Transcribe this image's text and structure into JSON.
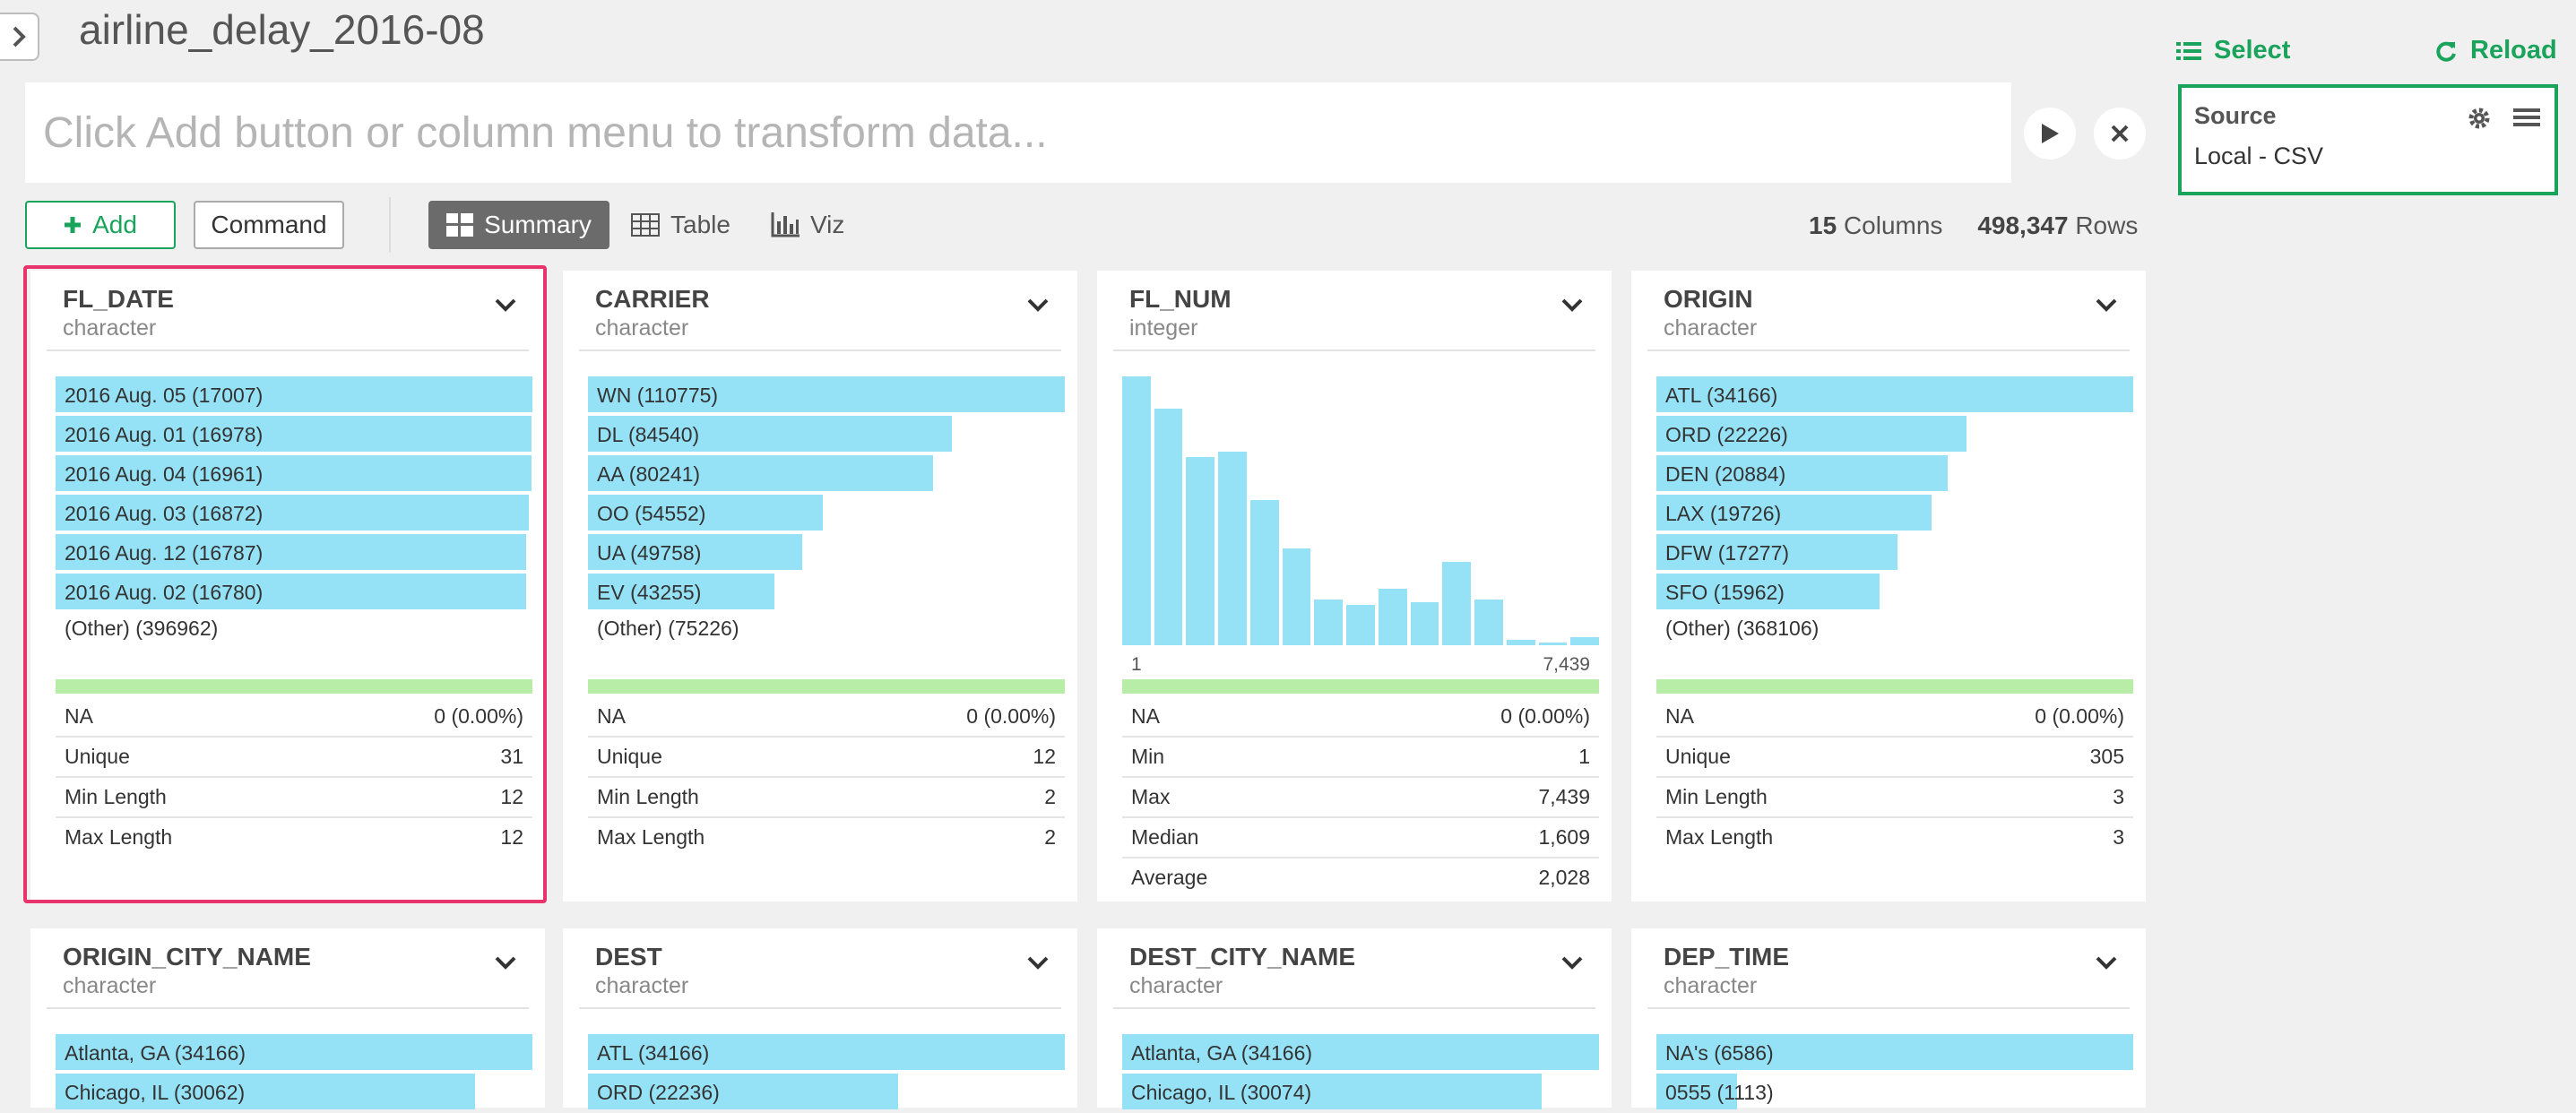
{
  "title": "airline_delay_2016-08",
  "command_placeholder": "Click Add button or column menu to transform data...",
  "right_panel": {
    "select_label": "Select",
    "reload_label": "Reload",
    "source_title": "Source",
    "source_value": "Local - CSV"
  },
  "toolbar": {
    "add_label": "Add",
    "command_label": "Command",
    "summary_label": "Summary",
    "table_label": "Table",
    "viz_label": "Viz",
    "columns_count": "15",
    "columns_label": "Columns",
    "rows_count": "498,347",
    "rows_label": "Rows"
  },
  "colors": {
    "accent": "#1aa35b",
    "bar": "#95e1f5",
    "na_bar": "#b8eda7",
    "selection": "#e8336b"
  },
  "cards": [
    {
      "name": "FL_DATE",
      "type": "character",
      "selected": true,
      "bars": [
        {
          "label": "2016 Aug. 05 (17007)",
          "count": 17007
        },
        {
          "label": "2016 Aug. 01 (16978)",
          "count": 16978
        },
        {
          "label": "2016 Aug. 04 (16961)",
          "count": 16961
        },
        {
          "label": "2016 Aug. 03 (16872)",
          "count": 16872
        },
        {
          "label": "2016 Aug. 12 (16787)",
          "count": 16787
        },
        {
          "label": "2016 Aug. 02 (16780)",
          "count": 16780
        }
      ],
      "other": "(Other) (396962)",
      "stats": [
        {
          "k": "NA",
          "v": "0 (0.00%)"
        },
        {
          "k": "Unique",
          "v": "31"
        },
        {
          "k": "Min Length",
          "v": "12"
        },
        {
          "k": "Max Length",
          "v": "12"
        }
      ]
    },
    {
      "name": "CARRIER",
      "type": "character",
      "bars": [
        {
          "label": "WN (110775)",
          "count": 110775
        },
        {
          "label": "DL (84540)",
          "count": 84540
        },
        {
          "label": "AA (80241)",
          "count": 80241
        },
        {
          "label": "OO (54552)",
          "count": 54552
        },
        {
          "label": "UA (49758)",
          "count": 49758
        },
        {
          "label": "EV (43255)",
          "count": 43255
        }
      ],
      "other": "(Other) (75226)",
      "stats": [
        {
          "k": "NA",
          "v": "0 (0.00%)"
        },
        {
          "k": "Unique",
          "v": "12"
        },
        {
          "k": "Min Length",
          "v": "2"
        },
        {
          "k": "Max Length",
          "v": "2"
        }
      ]
    },
    {
      "name": "FL_NUM",
      "type": "integer",
      "histogram": {
        "min_label": "1",
        "max_label": "7,439",
        "relative_heights": [
          1.0,
          0.88,
          0.7,
          0.72,
          0.54,
          0.36,
          0.17,
          0.15,
          0.21,
          0.16,
          0.31,
          0.17,
          0.02,
          0.01,
          0.03
        ]
      },
      "stats": [
        {
          "k": "NA",
          "v": "0 (0.00%)"
        },
        {
          "k": "Min",
          "v": "1"
        },
        {
          "k": "Max",
          "v": "7,439"
        },
        {
          "k": "Median",
          "v": "1,609"
        },
        {
          "k": "Average",
          "v": "2,028"
        }
      ]
    },
    {
      "name": "ORIGIN",
      "type": "character",
      "bars": [
        {
          "label": "ATL (34166)",
          "count": 34166
        },
        {
          "label": "ORD (22226)",
          "count": 22226
        },
        {
          "label": "DEN (20884)",
          "count": 20884
        },
        {
          "label": "LAX (19726)",
          "count": 19726
        },
        {
          "label": "DFW (17277)",
          "count": 17277
        },
        {
          "label": "SFO (15962)",
          "count": 15962
        }
      ],
      "other": "(Other) (368106)",
      "stats": [
        {
          "k": "NA",
          "v": "0 (0.00%)"
        },
        {
          "k": "Unique",
          "v": "305"
        },
        {
          "k": "Min Length",
          "v": "3"
        },
        {
          "k": "Max Length",
          "v": "3"
        }
      ]
    },
    {
      "name": "ORIGIN_CITY_NAME",
      "type": "character",
      "bars": [
        {
          "label": "Atlanta, GA (34166)",
          "count": 34166
        },
        {
          "label": "Chicago, IL (30062)",
          "count": 30062
        }
      ]
    },
    {
      "name": "DEST",
      "type": "character",
      "bars": [
        {
          "label": "ATL (34166)",
          "count": 34166
        },
        {
          "label": "ORD (22236)",
          "count": 22236
        }
      ]
    },
    {
      "name": "DEST_CITY_NAME",
      "type": "character",
      "bars": [
        {
          "label": "Atlanta, GA (34166)",
          "count": 34166
        },
        {
          "label": "Chicago, IL (30074)",
          "count": 30074
        }
      ]
    },
    {
      "name": "DEP_TIME",
      "type": "character",
      "bars": [
        {
          "label": "NA's (6586)",
          "count": 6586
        },
        {
          "label": "0555 (1113)",
          "count": 1113
        }
      ]
    }
  ]
}
